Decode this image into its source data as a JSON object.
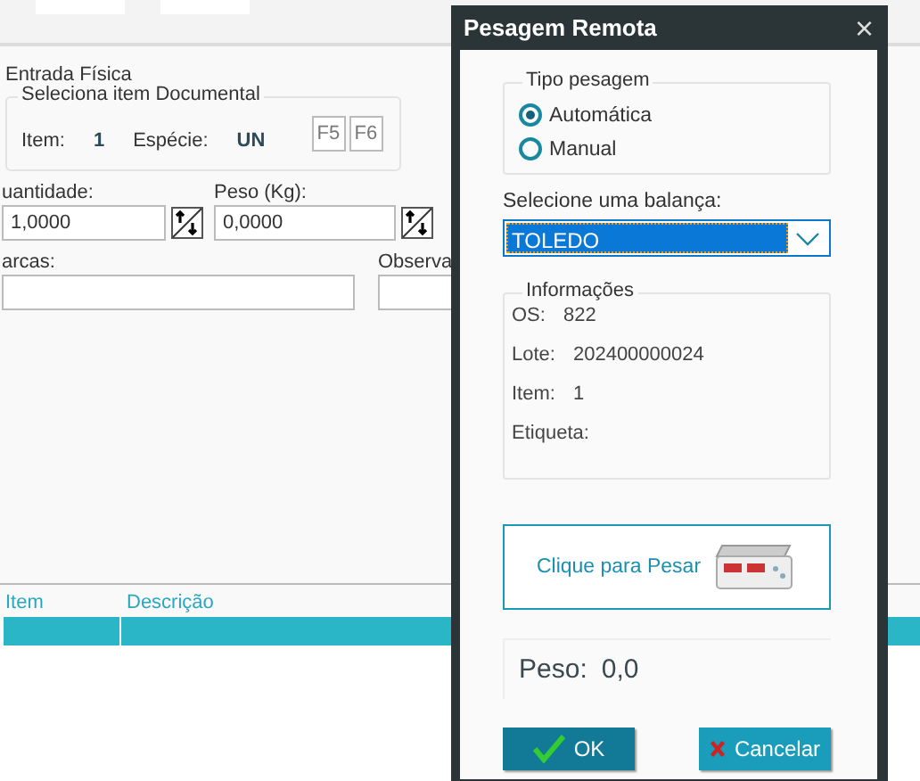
{
  "form": {
    "section_title": "Entrada Física",
    "group_title": "Seleciona item Documental",
    "item_label": "Item:",
    "item_value": "1",
    "especie_label": "Espécie:",
    "especie_value": "UN",
    "keys": [
      "F5",
      "F6"
    ],
    "quantity": {
      "label": "uantidade:",
      "value": "1,0000"
    },
    "weight": {
      "label": "Peso (Kg):",
      "value": "0,0000"
    },
    "marks": {
      "label": "arcas:"
    },
    "notes": {
      "label": "Observa"
    }
  },
  "table": {
    "columns": [
      "Item",
      "Descrição"
    ]
  },
  "dialog": {
    "title": "Pesagem Remota",
    "close": "×",
    "weighing_type": {
      "title": "Tipo pesagem",
      "options": [
        {
          "label": "Automática",
          "selected": true
        },
        {
          "label": "Manual",
          "selected": false
        }
      ]
    },
    "scale_label": "Selecione uma balança:",
    "scale_value": "TOLEDO",
    "info": {
      "title": "Informações",
      "rows": [
        {
          "label": "OS:",
          "value": "822"
        },
        {
          "label": "Lote:",
          "value": "202400000024"
        },
        {
          "label": "Item:",
          "value": "1"
        },
        {
          "label": "Etiqueta:"
        }
      ]
    },
    "weigh_button": "Clique para Pesar",
    "weight_label": "Peso:",
    "weight_value": "0,0",
    "buttons": [
      {
        "kind": "ok",
        "label": "OK"
      },
      {
        "kind": "cancel",
        "label": "Cancelar"
      }
    ]
  }
}
